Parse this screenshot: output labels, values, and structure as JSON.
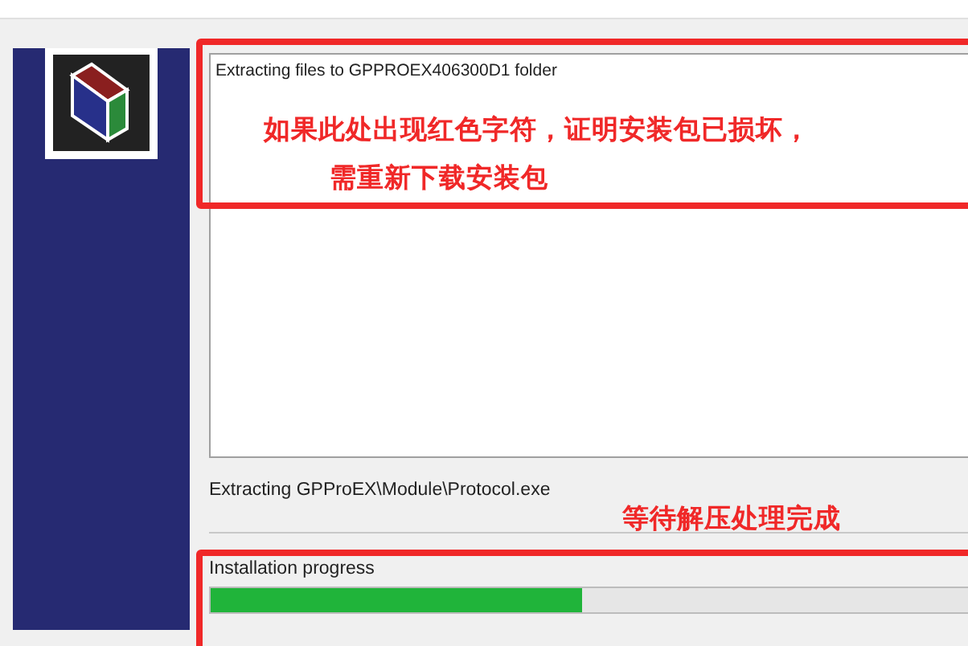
{
  "log": {
    "lines": [
      "Extracting files to GPPROEX406300D1 folder"
    ]
  },
  "annotations": [
    {
      "text": "如果此处出现红色字符，证明安装包已损坏，"
    },
    {
      "text": "需重新下载安装包"
    },
    {
      "text": "等待解压处理完成"
    }
  ],
  "current_file": "Extracting GPProEX\\Module\\Protocol.exe",
  "progress": {
    "label": "Installation progress",
    "level": 0.49
  }
}
